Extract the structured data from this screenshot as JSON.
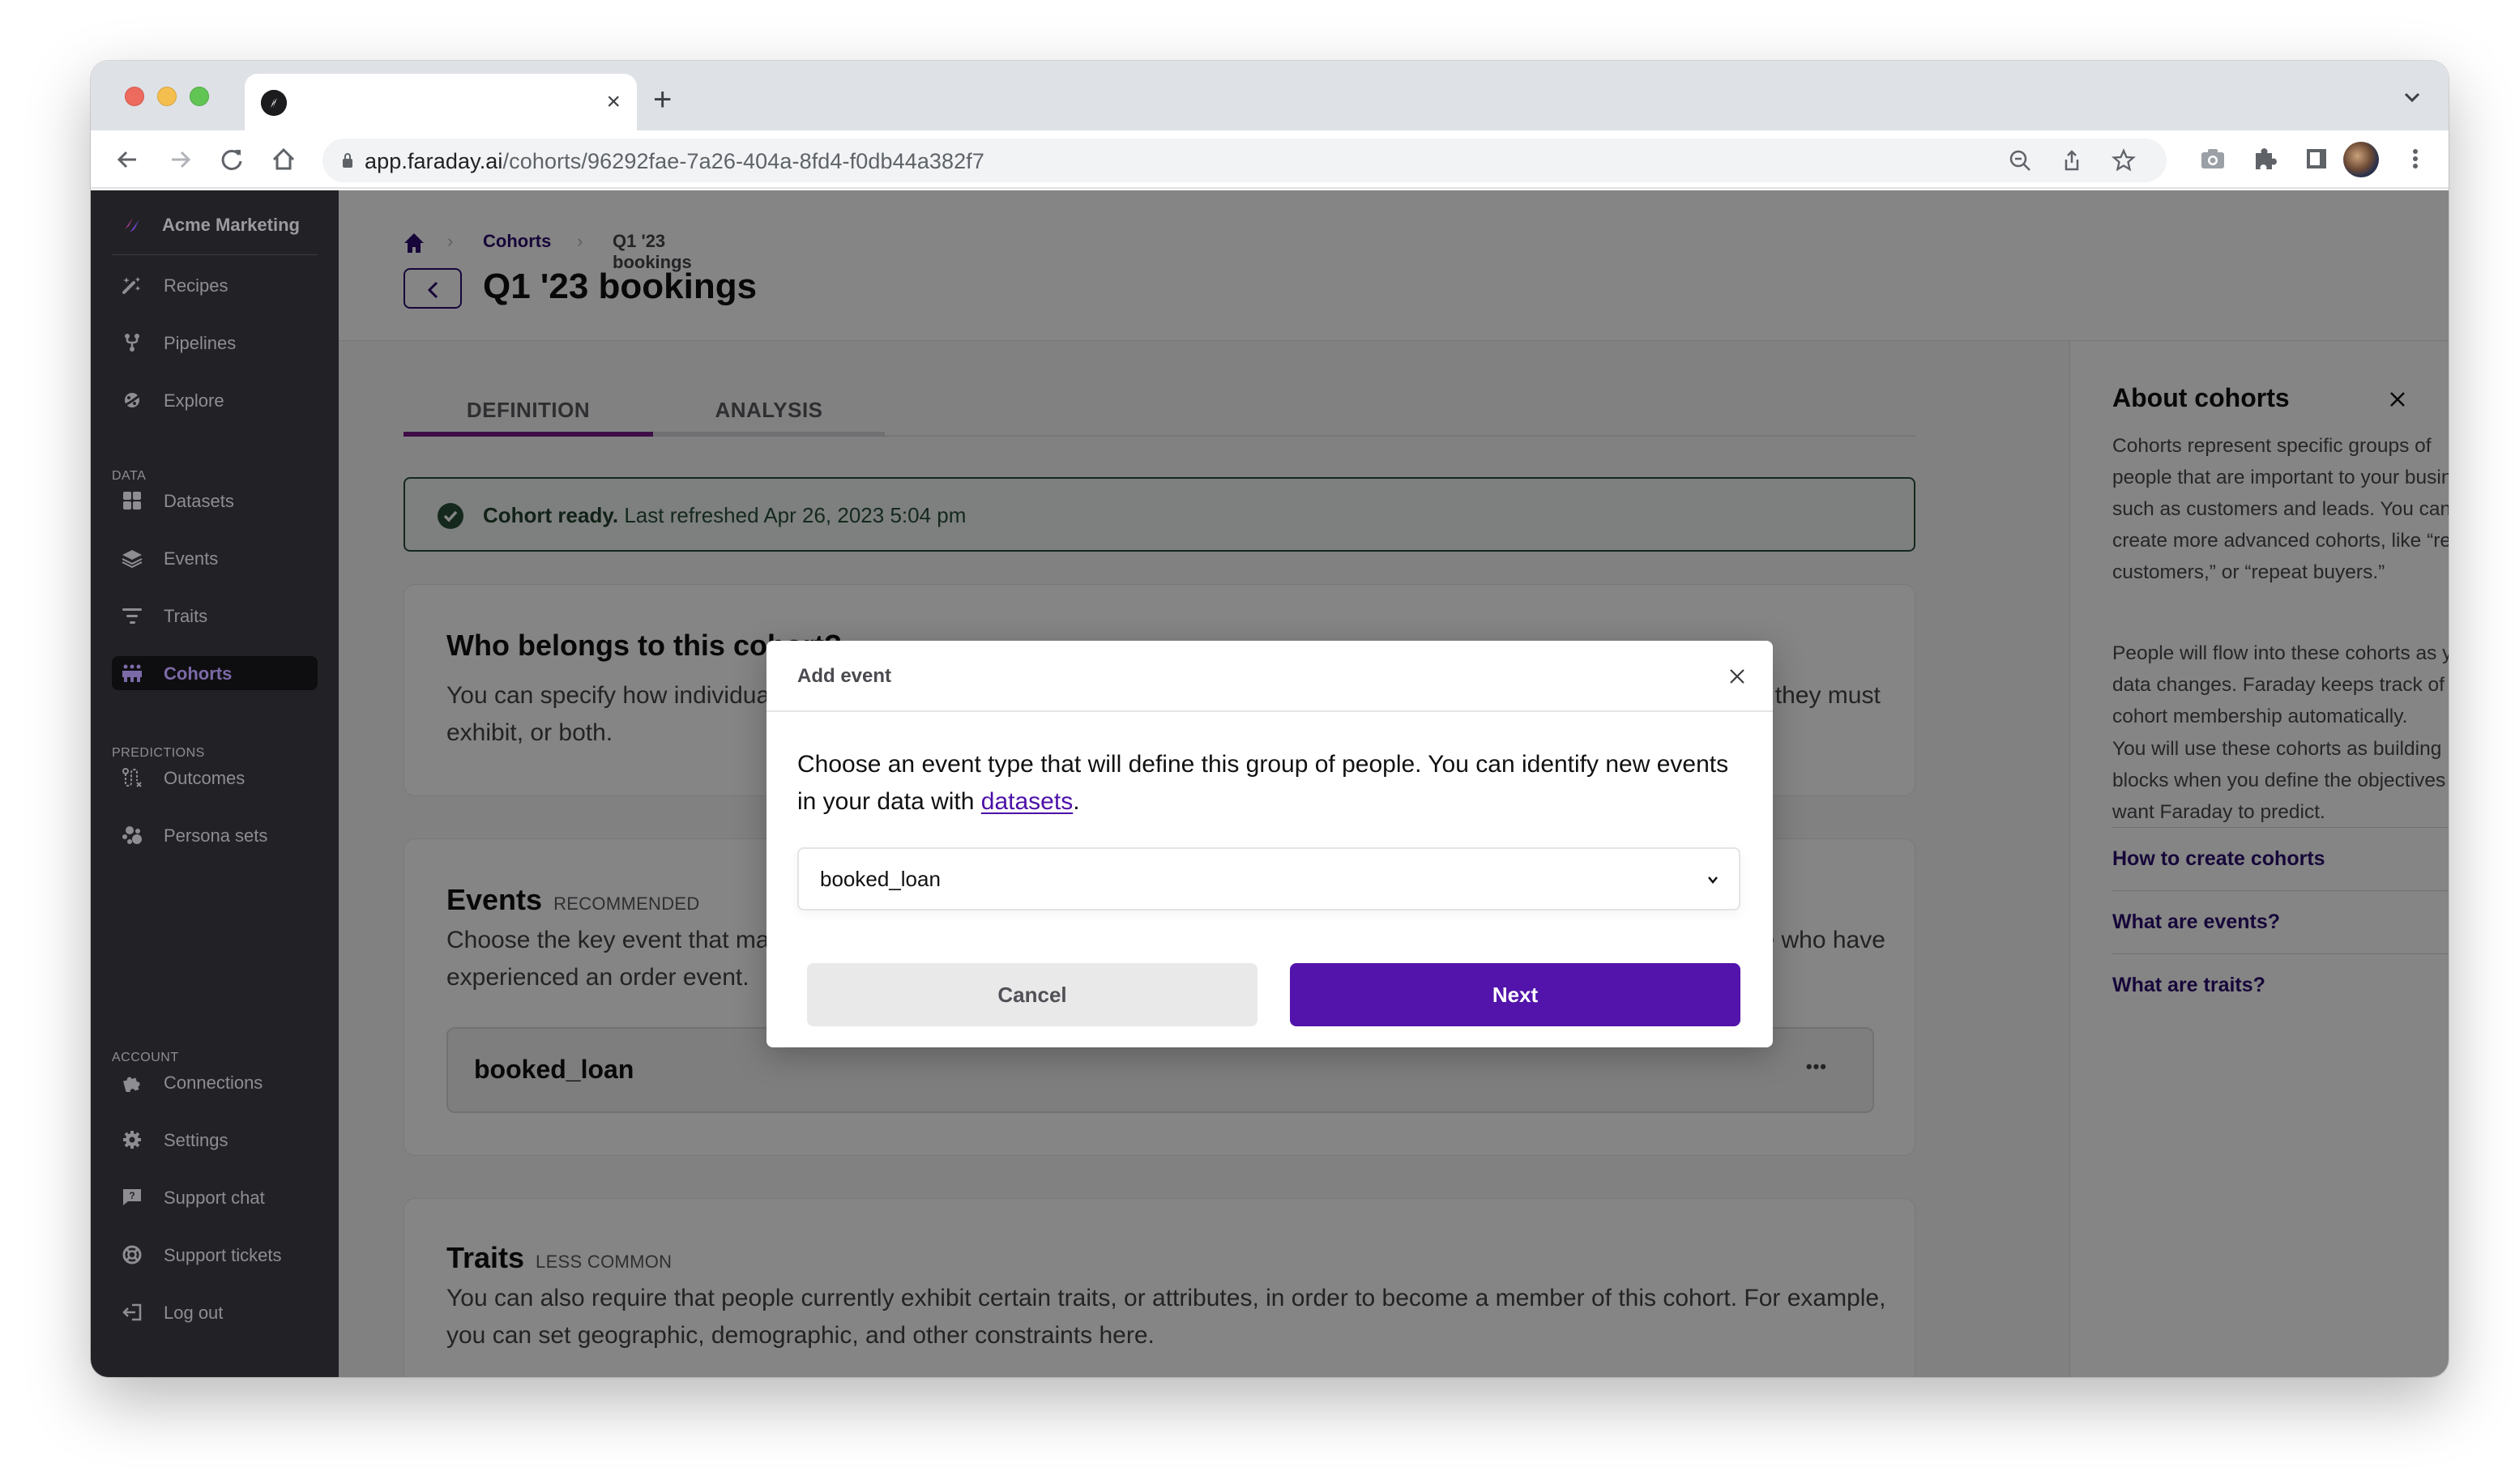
{
  "browser": {
    "tab_close": "×",
    "new_tab": "+",
    "url_host": "app.faraday.ai",
    "url_path": "/cohorts/96292fae-7a26-404a-8fd4-f0db44a382f7",
    "icons": [
      "back-arrow-icon",
      "forward-arrow-icon",
      "reload-icon",
      "home-icon",
      "lock-icon",
      "zoom-out-icon",
      "share-icon",
      "star-icon",
      "camera-icon",
      "extensions-icon",
      "side-panel-icon",
      "profile-avatar",
      "kebab-menu-icon"
    ]
  },
  "sidebar": {
    "org_name": "Acme Marketing",
    "items_top": [
      {
        "label": "Recipes",
        "icon": "magic-wand-icon"
      },
      {
        "label": "Pipelines",
        "icon": "pipeline-icon"
      },
      {
        "label": "Explore",
        "icon": "planet-icon"
      }
    ],
    "section_data": "DATA",
    "items_data": [
      {
        "label": "Datasets",
        "icon": "grid-icon"
      },
      {
        "label": "Events",
        "icon": "layers-icon"
      },
      {
        "label": "Traits",
        "icon": "filter-icon"
      },
      {
        "label": "Cohorts",
        "icon": "people-icon",
        "active": true
      }
    ],
    "section_predictions": "PREDICTIONS",
    "items_predictions": [
      {
        "label": "Outcomes",
        "icon": "route-icon"
      },
      {
        "label": "Persona sets",
        "icon": "dots-cluster-icon"
      }
    ],
    "section_account": "ACCOUNT",
    "items_account": [
      {
        "label": "Connections",
        "icon": "puzzle-icon"
      },
      {
        "label": "Settings",
        "icon": "gear-icon"
      },
      {
        "label": "Support chat",
        "icon": "question-bubble-icon"
      },
      {
        "label": "Support tickets",
        "icon": "lifebuoy-icon"
      },
      {
        "label": "Log out",
        "icon": "logout-icon"
      }
    ]
  },
  "header": {
    "breadcrumb": [
      "Cohorts",
      "Q1 '23 bookings"
    ],
    "title": "Q1 '23 bookings",
    "more_label": "•••"
  },
  "tabs": [
    {
      "label": "DEFINITION",
      "active": true
    },
    {
      "label": "ANALYSIS",
      "active": false
    }
  ],
  "status": {
    "bold": "Cohort ready.",
    "text": " Last refreshed Apr 26, 2023 5:04 pm",
    "color": "#2a4d3a"
  },
  "cards": {
    "who": {
      "title": "Who belongs to this cohort?",
      "body": "You can specify how individuals become members of this cohort, including which events they must have experienced, traits they must exhibit, or both."
    },
    "events": {
      "title": "Events",
      "tag": "RECOMMENDED",
      "body": "Choose the key event that marks entry into this cohort. For example, you might define a cohort of your customers as people who have experienced an order event.",
      "event_name": "booked_loan",
      "event_more": "•••"
    },
    "traits": {
      "title": "Traits",
      "tag": "LESS COMMON",
      "body": "You can also require that people currently exhibit certain traits, or attributes, in order to become a member of this cohort. For example, you can set geographic, demographic, and other constraints here."
    }
  },
  "right_panel": {
    "title": "About cohorts",
    "paragraphs": [
      "Cohorts represent specific groups of people that are important to your business, such as customers and leads. You can also create more advanced cohorts, like “recent customers,” or “repeat buyers.”",
      "People will flow into these cohorts as your data changes. Faraday keeps track of cohort membership automatically.",
      "You will use these cohorts as building blocks when you define the objectives you want Faraday to predict."
    ],
    "links": [
      {
        "label": "How to create cohorts"
      },
      {
        "label": "What are events?"
      },
      {
        "label": "What are traits?"
      }
    ]
  },
  "modal": {
    "title": "Add event",
    "desc_before": "Choose an event type that will define this group of people. You can identify new events in your data with ",
    "desc_link": "datasets",
    "desc_after": ".",
    "select_value": "booked_loan",
    "cancel_label": "Cancel",
    "next_label": "Next"
  },
  "colors": {
    "brand_purple": "#5214ab",
    "link_purple": "#2b0d6e",
    "tab_active": "#7a1a87",
    "sidebar_bg": "#222226",
    "chat_fab": "#b56ef0"
  }
}
